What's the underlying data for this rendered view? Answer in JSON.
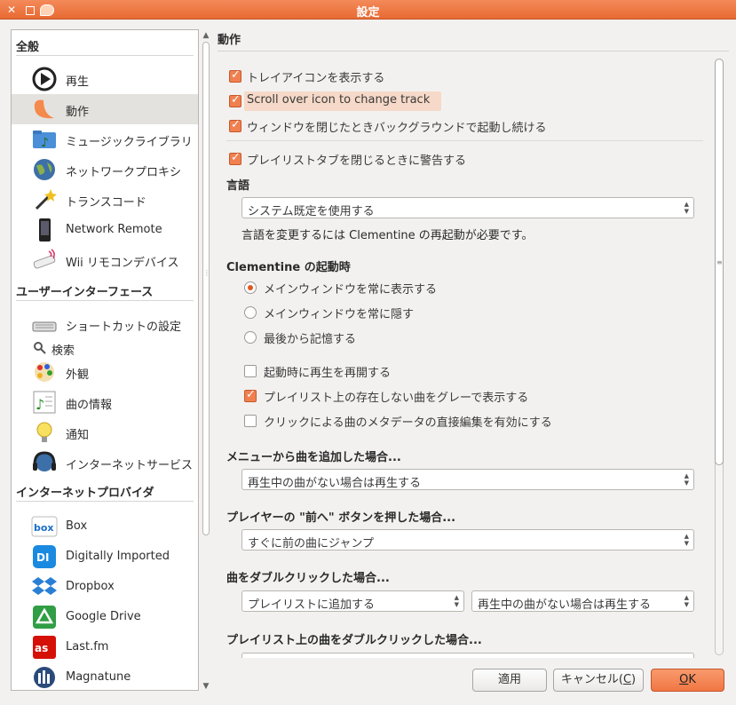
{
  "window": {
    "title": "設定"
  },
  "sidebar": {
    "groups": [
      {
        "label": "全般"
      },
      {
        "label": "ユーザーインターフェース"
      },
      {
        "label": "インターネットプロバイダ"
      }
    ],
    "items": [
      {
        "label": "再生",
        "icon": "play-icon"
      },
      {
        "label": "動作",
        "icon": "clementine-icon",
        "selected": true
      },
      {
        "label": "ミュージックライブラリ",
        "icon": "music-folder-icon"
      },
      {
        "label": "ネットワークプロキシ",
        "icon": "globe-icon"
      },
      {
        "label": "トランスコード",
        "icon": "wand-icon"
      },
      {
        "label": "Network Remote",
        "icon": "phone-icon"
      },
      {
        "label": "Wii リモコンデバイス",
        "icon": "wii-remote-icon"
      },
      {
        "label": "ショートカットの設定",
        "icon": "keyboard-icon"
      },
      {
        "label": "検索",
        "icon": "search-icon"
      },
      {
        "label": "外観",
        "icon": "palette-icon"
      },
      {
        "label": "曲の情報",
        "icon": "song-info-icon"
      },
      {
        "label": "通知",
        "icon": "lightbulb-icon"
      },
      {
        "label": "インターネットサービス",
        "icon": "headphones-icon"
      },
      {
        "label": "Box",
        "icon": "box-icon"
      },
      {
        "label": "Digitally Imported",
        "icon": "di-icon"
      },
      {
        "label": "Dropbox",
        "icon": "dropbox-icon"
      },
      {
        "label": "Google Drive",
        "icon": "google-drive-icon"
      },
      {
        "label": "Last.fm",
        "icon": "lastfm-icon"
      },
      {
        "label": "Magnatune",
        "icon": "magnatune-icon"
      }
    ]
  },
  "panel": {
    "title": "動作",
    "tray": [
      {
        "label": "トレイアイコンを表示する",
        "checked": true
      },
      {
        "label": "Scroll over icon to change track",
        "checked": true
      },
      {
        "label": "ウィンドウを閉じたときバックグラウンドで起動し続ける",
        "checked": true
      }
    ],
    "warn_close_tab": {
      "label": "プレイリストタブを閉じるときに警告する",
      "checked": true
    },
    "language": {
      "heading": "言語",
      "value": "システム既定を使用する",
      "note": "言語を変更するには Clementine の再起動が必要です。"
    },
    "startup": {
      "heading": "Clementine の起動時",
      "radios": [
        {
          "label": "メインウィンドウを常に表示する",
          "checked": true
        },
        {
          "label": "メインウィンドウを常に隠す",
          "checked": false
        },
        {
          "label": "最後から記憶する",
          "checked": false
        }
      ],
      "checks": [
        {
          "label": "起動時に再生を再開する",
          "checked": false
        },
        {
          "label": "プレイリスト上の存在しない曲をグレーで表示する",
          "checked": true
        },
        {
          "label": "クリックによる曲のメタデータの直接編集を有効にする",
          "checked": false
        }
      ]
    },
    "menu_add": {
      "heading": "メニューから曲を追加した場合...",
      "value": "再生中の曲がない場合は再生する"
    },
    "prev_button": {
      "heading": "プレイヤーの \"前へ\" ボタンを押した場合...",
      "value": "すぐに前の曲にジャンプ"
    },
    "double_click": {
      "heading": "曲をダブルクリックした場合...",
      "value1": "プレイリストに追加する",
      "value2": "再生中の曲がない場合は再生する"
    },
    "playlist_double_click": {
      "heading": "プレイリスト上の曲をダブルクリックした場合..."
    }
  },
  "buttons": {
    "apply": "適用",
    "cancel_main": "キャンセル(",
    "cancel_mnemonic": "C",
    "cancel_end": ")",
    "ok_mnemonic": "O",
    "ok_rest": "K"
  },
  "colors": {
    "accent": "#f07744",
    "titlebar": "#e86a32"
  }
}
